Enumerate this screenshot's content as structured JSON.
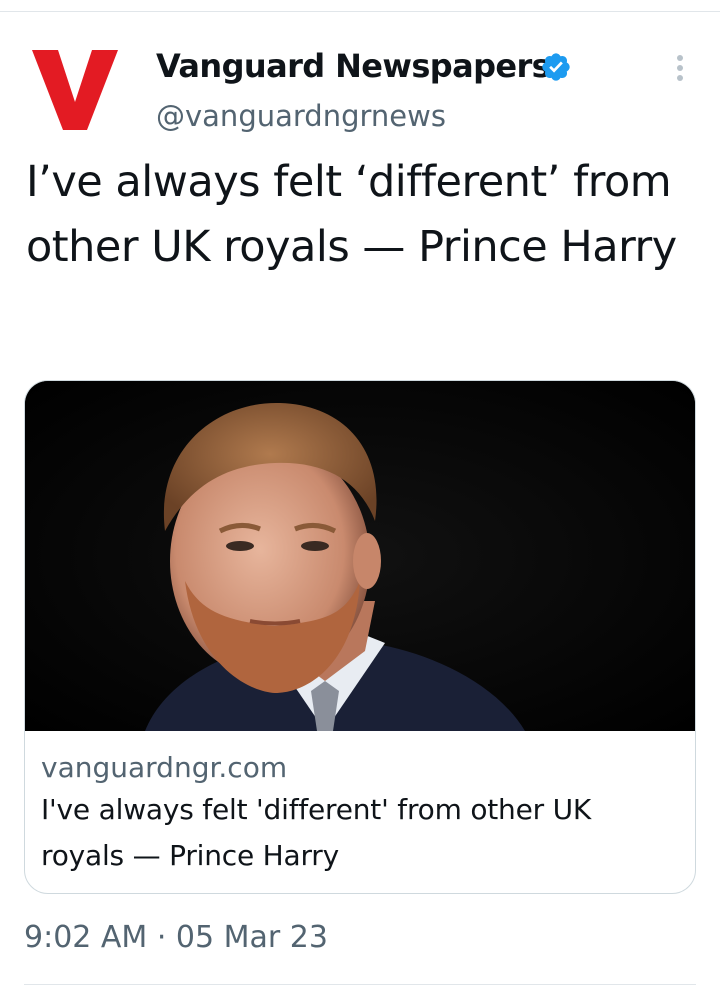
{
  "tweet": {
    "author": {
      "display_name": "Vanguard Newspapers",
      "handle": "@vanguardngrnews",
      "verified": true,
      "avatar_logo": "V",
      "avatar_color": "#e31b23"
    },
    "text": "I’ve always felt ‘different’ from other UK royals — Prince Harry",
    "card": {
      "image_alt": "Prince Harry",
      "domain": "vanguardngr.com",
      "title": "I've always felt 'different' from other UK royals — Prince Harry"
    },
    "timestamp": "9:02 AM · 05 Mar 23"
  },
  "colors": {
    "text_primary": "#0f1419",
    "text_secondary": "#536471",
    "verified_blue": "#1d9bf0",
    "divider": "#e1e6ea"
  },
  "icons": {
    "verified": "verified-badge-icon",
    "more": "more-vertical-icon"
  }
}
